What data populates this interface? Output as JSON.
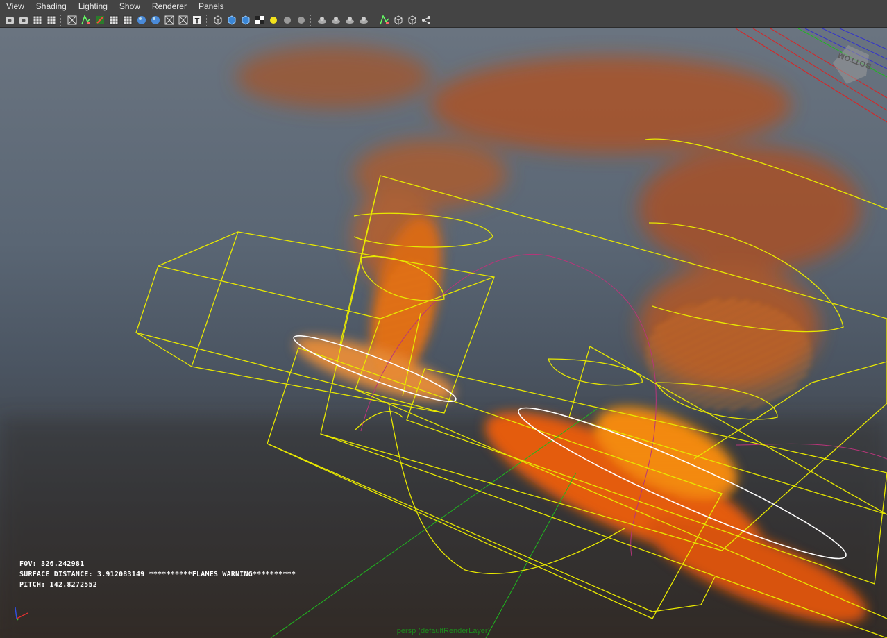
{
  "menubar": {
    "items": [
      "View",
      "Shading",
      "Lighting",
      "Show",
      "Renderer",
      "Panels"
    ]
  },
  "toolbar": {
    "icons": [
      "camera-select-icon",
      "camera-attributes-icon",
      "bookmarks-icon",
      "image-plane-icon",
      "grid-icon",
      "film-gate-icon",
      "resolution-gate-icon",
      "wireframe-icon",
      "smooth-shade-icon",
      "isolate-icon",
      "xray-icon",
      "xray-joints-icon",
      "xray-components-icon",
      "textured-icon",
      "default-light-icon",
      "all-lights-icon",
      "shadows-icon",
      "checker-icon",
      "use-lights-icon",
      "ambient-occlusion-icon",
      "motion-blur-icon",
      "multisample-icon",
      "depth-of-field-icon",
      "screen-space-icon",
      "hardware-fog-icon",
      "select-camera-icon",
      "ortho-view-icon",
      "two-panel-icon",
      "share-icon"
    ]
  },
  "hud": {
    "fov": "FOV: 326.242981",
    "surface_distance": "SURFACE DISTANCE: 3.912083149 **********FLAMES WARNING**********",
    "pitch": "PITCH: 142.8272552"
  },
  "viewcube": {
    "label": "BOTTOM"
  },
  "camera_label": "persp (defaultRenderLayer)",
  "colors": {
    "ui_background": "#444444",
    "wireframe": "#e8e800",
    "grid_axis": "#1fb81f",
    "fire": "#e0621a"
  }
}
